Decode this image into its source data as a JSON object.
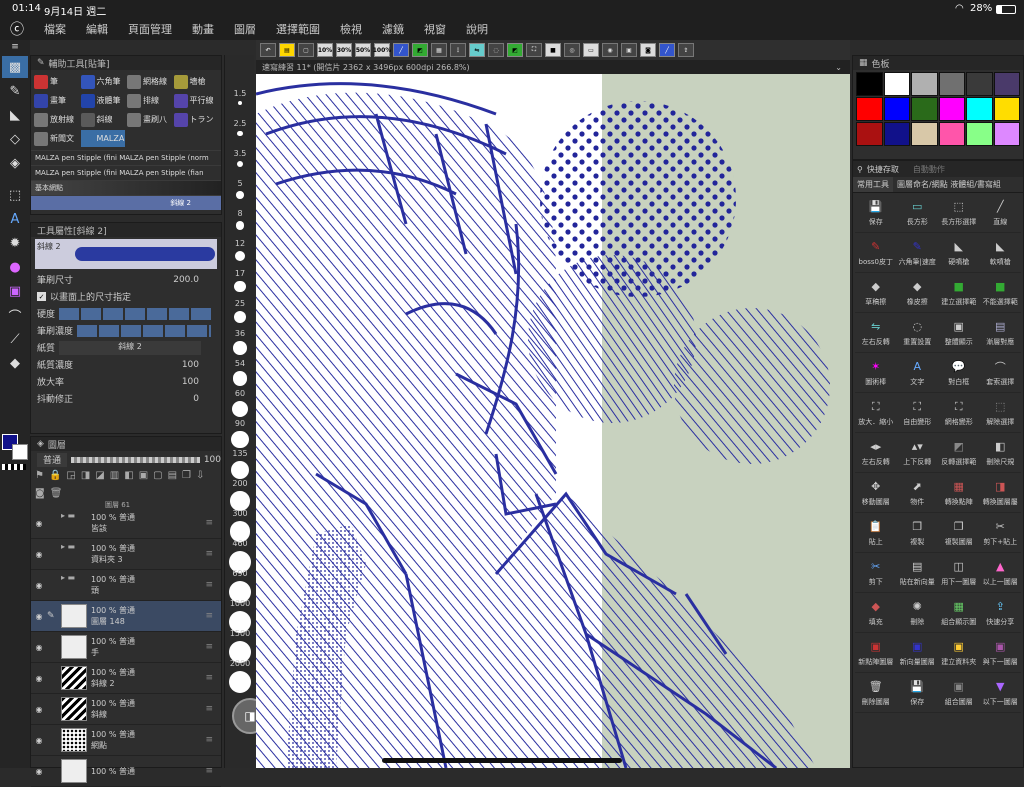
{
  "status": {
    "time": "01:14",
    "date": "9月14日 週二",
    "battery": "28%"
  },
  "menu": [
    "檔案",
    "編輯",
    "頁面管理",
    "動畫",
    "圖層",
    "選擇範圍",
    "檢視",
    "濾鏡",
    "視窗",
    "說明"
  ],
  "command_bar": [
    "10%",
    "30%",
    "50%",
    "100%"
  ],
  "canvas_tab": "速寫練習 11* (開信片 2362 x 3496px 600dpi 266.8%)",
  "subtool": {
    "title": "輔助工具[貼筆]",
    "items": [
      {
        "label": "筆",
        "color": "#c33"
      },
      {
        "label": "六角筆",
        "color": "#3355bb"
      },
      {
        "label": "網格線",
        "color": "#777"
      },
      {
        "label": "墻槍",
        "color": "#a59a3a"
      },
      {
        "label": "畫筆",
        "color": "#3344aa"
      },
      {
        "label": "液體筆",
        "color": "#2244aa"
      },
      {
        "label": "排線",
        "color": "#777"
      },
      {
        "label": "平行線",
        "color": "#5544aa"
      },
      {
        "label": "放射線",
        "color": "#777"
      },
      {
        "label": "斜線",
        "color": "#5a5a5a"
      },
      {
        "label": "畫刷八",
        "color": "#777"
      },
      {
        "label": "トラン",
        "color": "#5544aa"
      },
      {
        "label": "新聞文",
        "color": "#777"
      },
      {
        "label": "MALZA",
        "color": "#3a6ea5"
      }
    ],
    "brushes": [
      "MALZA pen Stipple (fini  MALZA pen Stipple (norm",
      "MALZA pen Stipple (fini  MALZA pen Stipple (fian",
      "基本網點",
      "斜線 2"
    ]
  },
  "ruler_ticks": [
    "1.5",
    "2.5",
    "3.5",
    "5",
    "8",
    "12",
    "17",
    "25",
    "36",
    "54",
    "60",
    "90",
    "135",
    "200",
    "300",
    "460",
    "690",
    "1000",
    "1500",
    "2000"
  ],
  "props": {
    "title": "工具屬性[斜線 2]",
    "brush_name": "斜線 2",
    "size_label": "筆刷尺寸",
    "size_value": "200.0",
    "checkbox": "以畫面上的尺寸指定",
    "hardness": "硬度",
    "density": "筆刷濃度",
    "paper": "紙質",
    "paper_value": "斜線 2",
    "paper_density": "紙質濃度",
    "paper_density_value": "100",
    "scale": "放大率",
    "scale_value": "100",
    "stabilize": "抖動修正",
    "stabilize_value": "0"
  },
  "layers": {
    "title": "圖層",
    "blend": "普通",
    "opacity": "100",
    "rows": [
      {
        "pct": "100 % 普通",
        "name": "皆該"
      },
      {
        "pct": "100 % 普通",
        "name": "資料夾 3"
      },
      {
        "pct": "100 % 普通",
        "name": "頭"
      },
      {
        "pct": "100 % 普通",
        "name": "圖層 148"
      },
      {
        "pct": "100 % 普通",
        "name": "手"
      },
      {
        "pct": "100 % 普通",
        "name": "斜線 2"
      },
      {
        "pct": "100 % 普通",
        "name": "斜線"
      },
      {
        "pct": "100 % 普通",
        "name": "網點"
      },
      {
        "pct": "100 % 普通",
        "name": ""
      }
    ],
    "top_partial": "圖層 61"
  },
  "palette": {
    "title": "色板",
    "colors": [
      "#000000",
      "#ffffff",
      "#b0b0b0",
      "#707070",
      "#3a3a3a",
      "#4a3a6a",
      "#ff0000",
      "#0000ff",
      "#2a6a1a",
      "#ff00ff",
      "#00ffff",
      "#ffdd00",
      "#aa1111",
      "#11118a",
      "#d8c8a8",
      "#ff55aa",
      "#88ff88",
      "#dd88ff"
    ]
  },
  "quick": {
    "tab1": "快捷存取",
    "tab2": "自動動作",
    "tabs": [
      "常用工具",
      "圖層命名/網點 液體組/書寫組"
    ],
    "items": [
      {
        "label": "保存",
        "icon": "💾",
        "color": "#ffd700"
      },
      {
        "label": "長方形",
        "icon": "▭",
        "color": "#6cc"
      },
      {
        "label": "長方形選擇",
        "icon": "⬚",
        "color": "#ccc"
      },
      {
        "label": "直線",
        "icon": "╱",
        "color": "#ccc"
      },
      {
        "label": "boss0皮丁",
        "icon": "✎",
        "color": "#c33"
      },
      {
        "label": "六角筆|速度",
        "icon": "✎",
        "color": "#33c"
      },
      {
        "label": "硬噴槍",
        "icon": "◣",
        "color": "#ccc"
      },
      {
        "label": "軟噴槍",
        "icon": "◣",
        "color": "#ccc"
      },
      {
        "label": "草稿擦",
        "icon": "◆",
        "color": "#ccc"
      },
      {
        "label": "橡皮擦",
        "icon": "◆",
        "color": "#ccc"
      },
      {
        "label": "建立選擇範",
        "icon": "■",
        "color": "#3a3"
      },
      {
        "label": "不能選擇範",
        "icon": "■",
        "color": "#3a3"
      },
      {
        "label": "左右反轉",
        "icon": "⇋",
        "color": "#6cc"
      },
      {
        "label": "重置設置",
        "icon": "◌",
        "color": "#ccc"
      },
      {
        "label": "整體顯示",
        "icon": "▣",
        "color": "#ccc"
      },
      {
        "label": "漸層對應",
        "icon": "▤",
        "color": "#aac"
      },
      {
        "label": "圖術棒",
        "icon": "✶",
        "color": "#f0f"
      },
      {
        "label": "文字",
        "icon": "A",
        "color": "#6af"
      },
      {
        "label": "對白框",
        "icon": "💬",
        "color": "#ccc"
      },
      {
        "label": "套索選擇",
        "icon": "⌒",
        "color": "#ccc"
      },
      {
        "label": "放大．縮小",
        "icon": "⛶",
        "color": "#ccc"
      },
      {
        "label": "自由變形",
        "icon": "⛶",
        "color": "#ccc"
      },
      {
        "label": "網格變形",
        "icon": "⛶",
        "color": "#ccc"
      },
      {
        "label": "解除選擇",
        "icon": "⬚",
        "color": "#888"
      },
      {
        "label": "左右反轉",
        "icon": "◂▸",
        "color": "#ccc"
      },
      {
        "label": "上下反轉",
        "icon": "▴▾",
        "color": "#ccc"
      },
      {
        "label": "反轉選擇範",
        "icon": "◩",
        "color": "#888"
      },
      {
        "label": "刪除尺規",
        "icon": "◧",
        "color": "#ccc"
      },
      {
        "label": "移動圖層",
        "icon": "✥",
        "color": "#ccc"
      },
      {
        "label": "物件",
        "icon": "⬈",
        "color": "#ccc"
      },
      {
        "label": "轉換點陣",
        "icon": "▦",
        "color": "#c55"
      },
      {
        "label": "轉換圖層屬",
        "icon": "◨",
        "color": "#c55"
      },
      {
        "label": "貼上",
        "icon": "📋",
        "color": "#888"
      },
      {
        "label": "複製",
        "icon": "❐",
        "color": "#ccc"
      },
      {
        "label": "複製圖層",
        "icon": "❐",
        "color": "#ccc"
      },
      {
        "label": "剪下+貼上",
        "icon": "✂",
        "color": "#ccc"
      },
      {
        "label": "剪下",
        "icon": "✂",
        "color": "#6af"
      },
      {
        "label": "貼在新向量",
        "icon": "▤",
        "color": "#ccc"
      },
      {
        "label": "用下一圖層",
        "icon": "◫",
        "color": "#ccc"
      },
      {
        "label": "以上一圖層",
        "icon": "▲",
        "color": "#f6c"
      },
      {
        "label": "填充",
        "icon": "◆",
        "color": "#c55"
      },
      {
        "label": "刪除",
        "icon": "✺",
        "color": "#ccc"
      },
      {
        "label": "組合顯示圖",
        "icon": "▦",
        "color": "#6c6"
      },
      {
        "label": "快速分享",
        "icon": "⇪",
        "color": "#6cf"
      },
      {
        "label": "新點陣圖層",
        "icon": "▣",
        "color": "#c33"
      },
      {
        "label": "新向量圖層",
        "icon": "▣",
        "color": "#33c"
      },
      {
        "label": "建立資料夾",
        "icon": "▣",
        "color": "#fc3"
      },
      {
        "label": "與下一圖層",
        "icon": "▣",
        "color": "#a5a"
      },
      {
        "label": "刪除圖層",
        "icon": "🗑",
        "color": "#ccc"
      },
      {
        "label": "保存",
        "icon": "💾",
        "color": "#ffd700"
      },
      {
        "label": "組合圖層",
        "icon": "▣",
        "color": "#888"
      },
      {
        "label": "以下一圖層",
        "icon": "▼",
        "color": "#a6f"
      }
    ]
  }
}
